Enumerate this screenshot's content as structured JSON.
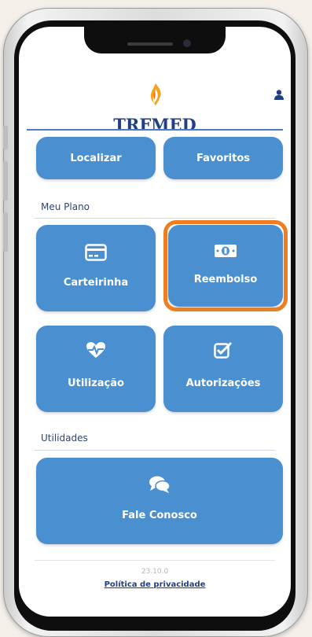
{
  "header": {
    "brand": "TRFMED",
    "brand_color": "#1f3f88",
    "flame_colors": [
      "#f7a21b",
      "#e8711a"
    ]
  },
  "top_tiles": [
    {
      "label": "Localizar"
    },
    {
      "label": "Favoritos"
    }
  ],
  "meu_plano": {
    "title": "Meu Plano",
    "tiles": [
      {
        "label": "Carteirinha",
        "icon": "card-icon"
      },
      {
        "label": "Reembolso",
        "icon": "money-icon",
        "highlighted": true
      },
      {
        "label": "Utilização",
        "icon": "heart-pulse-icon"
      },
      {
        "label": "Autorizações",
        "icon": "checkbox-icon"
      }
    ]
  },
  "utilidades": {
    "title": "Utilidades",
    "tiles": [
      {
        "label": "Fale Conosco",
        "icon": "chat-bubbles-icon"
      }
    ]
  },
  "footer": {
    "version": "23.10.0",
    "privacy_link": "Política de privacidade"
  },
  "colors": {
    "tile_blue": "#4a8fd0",
    "highlight_orange": "#ef7d22",
    "accent_line": "#4a7bc6"
  }
}
